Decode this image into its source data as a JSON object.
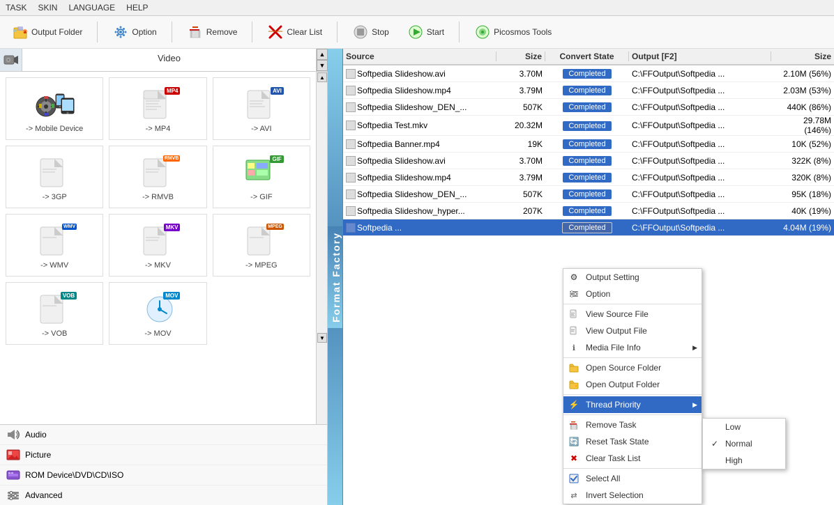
{
  "menubar": {
    "items": [
      "TASK",
      "SKIN",
      "LANGUAGE",
      "HELP"
    ]
  },
  "toolbar": {
    "buttons": [
      {
        "id": "output-folder",
        "label": "Output Folder",
        "icon": "folder-icon"
      },
      {
        "id": "option",
        "label": "Option",
        "icon": "gear-icon"
      },
      {
        "id": "remove",
        "label": "Remove",
        "icon": "remove-icon"
      },
      {
        "id": "clear-list",
        "label": "Clear List",
        "icon": "clearlist-icon"
      },
      {
        "id": "stop",
        "label": "Stop",
        "icon": "stop-icon"
      },
      {
        "id": "start",
        "label": "Start",
        "icon": "start-icon"
      },
      {
        "id": "picosmos-tools",
        "label": "Picosmos Tools",
        "icon": "picosmos-icon"
      }
    ]
  },
  "left_panel": {
    "header": "Video",
    "formats": [
      {
        "id": "mobile",
        "label": "-> Mobile Device",
        "badge": null
      },
      {
        "id": "mp4",
        "label": "-> MP4",
        "badge": "MP4"
      },
      {
        "id": "avi",
        "label": "-> AVI",
        "badge": "AVI"
      },
      {
        "id": "3gp",
        "label": "-> 3GP",
        "badge": null
      },
      {
        "id": "rmvb",
        "label": "-> RMVB",
        "badge": "RMVB"
      },
      {
        "id": "gif",
        "label": "-> GIF",
        "badge": "GIF"
      },
      {
        "id": "wmv",
        "label": "-> WMV",
        "badge": "WMV"
      },
      {
        "id": "mkv",
        "label": "-> MKV",
        "badge": "MKV"
      },
      {
        "id": "mpeg",
        "label": "-> MPEG",
        "badge": "MPEG"
      },
      {
        "id": "vob",
        "label": "-> VOB",
        "badge": "VOB"
      },
      {
        "id": "mov",
        "label": "-> MOV",
        "badge": "MOV"
      }
    ],
    "sidebar_labels": [
      "Audio",
      "Picture",
      "ROM Device\\DVD\\CD\\ISO",
      "Advanced"
    ]
  },
  "table": {
    "columns": [
      "Source",
      "Size",
      "Convert State",
      "Output [F2]",
      "Size"
    ],
    "rows": [
      {
        "source": "Softpedia Slideshow.avi",
        "size": "3.70M",
        "state": "Completed",
        "output": "C:\\FFOutput\\Softpedia ...",
        "outsize": "2.10M (56%)"
      },
      {
        "source": "Softpedia Slideshow.mp4",
        "size": "3.79M",
        "state": "Completed",
        "output": "C:\\FFOutput\\Softpedia ...",
        "outsize": "2.03M (53%)"
      },
      {
        "source": "Softpedia Slideshow_DEN_...",
        "size": "507K",
        "state": "Completed",
        "output": "C:\\FFOutput\\Softpedia ...",
        "outsize": "440K (86%)"
      },
      {
        "source": "Softpedia Test.mkv",
        "size": "20.32M",
        "state": "Completed",
        "output": "C:\\FFOutput\\Softpedia ...",
        "outsize": "29.78M (146%)"
      },
      {
        "source": "Softpedia Banner.mp4",
        "size": "19K",
        "state": "Completed",
        "output": "C:\\FFOutput\\Softpedia ...",
        "outsize": "10K (52%)"
      },
      {
        "source": "Softpedia Slideshow.avi",
        "size": "3.70M",
        "state": "Completed",
        "output": "C:\\FFOutput\\Softpedia ...",
        "outsize": "322K (8%)"
      },
      {
        "source": "Softpedia Slideshow.mp4",
        "size": "3.79M",
        "state": "Completed",
        "output": "C:\\FFOutput\\Softpedia ...",
        "outsize": "320K (8%)"
      },
      {
        "source": "Softpedia Slideshow_DEN_...",
        "size": "507K",
        "state": "Completed",
        "output": "C:\\FFOutput\\Softpedia ...",
        "outsize": "95K (18%)"
      },
      {
        "source": "Softpedia Slideshow_hyper...",
        "size": "207K",
        "state": "Completed",
        "output": "C:\\FFOutput\\Softpedia ...",
        "outsize": "40K (19%)"
      },
      {
        "source": "Softpedia ...",
        "size": "",
        "state": "Completed",
        "output": "C:\\FFOutput\\Softpedia ...",
        "outsize": "4.04M (19%)",
        "selected": true
      }
    ]
  },
  "context_menu": {
    "items": [
      {
        "id": "output-setting",
        "label": "Output Setting",
        "icon": "⚙",
        "has_arrow": false
      },
      {
        "id": "option",
        "label": "Option",
        "icon": "🔧",
        "has_arrow": false
      },
      {
        "id": "sep1",
        "separator": true
      },
      {
        "id": "view-source",
        "label": "View Source File",
        "icon": "📄",
        "has_arrow": false
      },
      {
        "id": "view-output",
        "label": "View Output File",
        "icon": "📄",
        "has_arrow": false
      },
      {
        "id": "media-info",
        "label": "Media File Info",
        "icon": "ℹ",
        "has_arrow": true
      },
      {
        "id": "sep2",
        "separator": true
      },
      {
        "id": "open-source",
        "label": "Open Source Folder",
        "icon": "📁",
        "has_arrow": false
      },
      {
        "id": "open-output",
        "label": "Open Output Folder",
        "icon": "📁",
        "has_arrow": false
      },
      {
        "id": "sep3",
        "separator": true
      },
      {
        "id": "thread-priority",
        "label": "Thread Priority",
        "icon": "⚡",
        "has_arrow": true,
        "highlighted": true
      },
      {
        "id": "sep4",
        "separator": true
      },
      {
        "id": "remove-task",
        "label": "Remove Task",
        "icon": "✖",
        "has_arrow": false
      },
      {
        "id": "reset-task",
        "label": "Reset Task State",
        "icon": "🔄",
        "has_arrow": false
      },
      {
        "id": "clear-task",
        "label": "Clear Task List",
        "icon": "✖",
        "has_arrow": false
      },
      {
        "id": "sep5",
        "separator": true
      },
      {
        "id": "select-all",
        "label": "Select All",
        "icon": "☑",
        "has_arrow": false
      },
      {
        "id": "invert-selection",
        "label": "Invert Selection",
        "icon": "⇄",
        "has_arrow": false
      }
    ]
  },
  "submenu": {
    "items": [
      {
        "id": "low",
        "label": "Low",
        "checked": false
      },
      {
        "id": "normal",
        "label": "Normal",
        "checked": true
      },
      {
        "id": "high",
        "label": "High",
        "checked": false
      }
    ]
  },
  "format_factory_label": "Format Factory",
  "colors": {
    "completed_badge": "#316ac5",
    "selected_row": "#316ac5",
    "accent": "#4682B4"
  }
}
